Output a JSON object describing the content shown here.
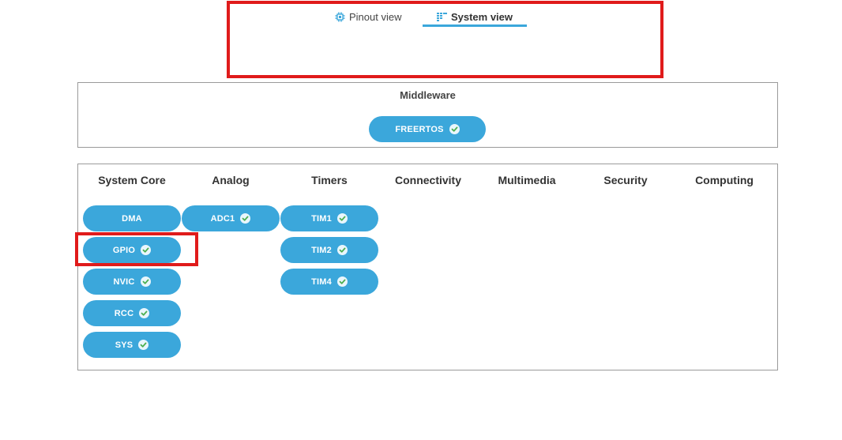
{
  "tabs": [
    {
      "label": "Pinout view",
      "icon": "chip-icon",
      "active": false
    },
    {
      "label": "System view",
      "icon": "list-grid-icon",
      "active": true
    }
  ],
  "middleware": {
    "title": "Middleware",
    "items": [
      {
        "label": "FREERTOS",
        "checked": true
      }
    ]
  },
  "categories": [
    {
      "title": "System Core",
      "items": [
        {
          "label": "DMA",
          "checked": false
        },
        {
          "label": "GPIO",
          "checked": true
        },
        {
          "label": "NVIC",
          "checked": true
        },
        {
          "label": "RCC",
          "checked": true
        },
        {
          "label": "SYS",
          "checked": true
        }
      ]
    },
    {
      "title": "Analog",
      "items": [
        {
          "label": "ADC1",
          "checked": true
        }
      ]
    },
    {
      "title": "Timers",
      "items": [
        {
          "label": "TIM1",
          "checked": true
        },
        {
          "label": "TIM2",
          "checked": true
        },
        {
          "label": "TIM4",
          "checked": true
        }
      ]
    },
    {
      "title": "Connectivity",
      "items": []
    },
    {
      "title": "Multimedia",
      "items": []
    },
    {
      "title": "Security",
      "items": []
    },
    {
      "title": "Computing",
      "items": []
    }
  ],
  "colors": {
    "accent": "#3ba7db",
    "annotation": "#e01b1b",
    "check": "#4caf50"
  }
}
